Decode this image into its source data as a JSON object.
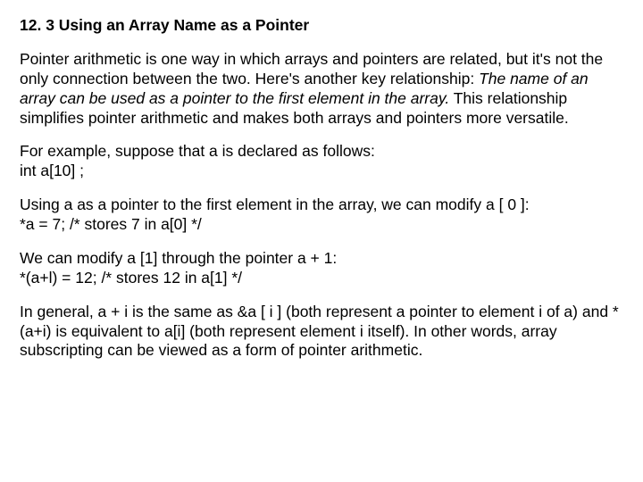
{
  "heading": "12. 3 Using an Array Name as a Pointer",
  "p1_part1": "Pointer arithmetic is one way in which arrays and pointers are related, but it's not the only connection between the two. Here's another key relationship: ",
  "p1_italic": "The name of an array can be used as a pointer to the first element in the array.",
  "p1_part2": " This relationship simplifies pointer arithmetic and makes both arrays and pointers more versatile.",
  "p2_line1": "For example, suppose that a is declared as follows:",
  "p2_line2": "int a[10] ;",
  "p3_line1": "Using a as a pointer to the first element in the array, we can modify a [ 0 ]:",
  "p3_line2": "*a = 7;   /* stores 7 in a[0] */",
  "p4_line1": "We can modify a [1] through the pointer a + 1:",
  "p4_line2": "*(a+l) = 12;   /* stores 12 in a[1] */",
  "p5": "In general, a + i is the same as &a [ i ] (both represent a pointer to element i of a) and * (a+i) is equivalent to a[i] (both represent element i itself). In other words, array subscripting can be viewed as a form of pointer arithmetic."
}
